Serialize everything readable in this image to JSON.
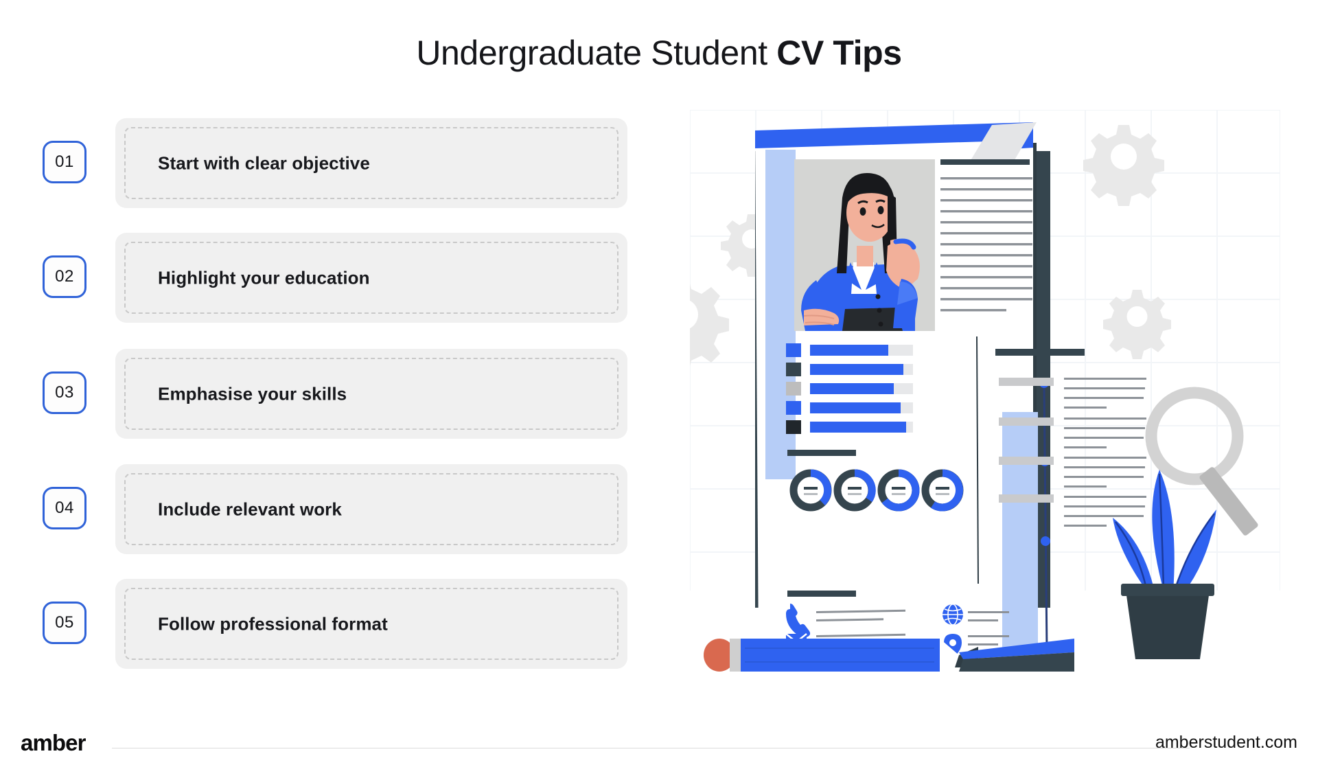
{
  "header": {
    "title_regular": "Undergraduate Student ",
    "title_bold": "CV Tips"
  },
  "tips": [
    {
      "number": "01",
      "label": "Start with clear objective"
    },
    {
      "number": "02",
      "label": "Highlight your education"
    },
    {
      "number": "03",
      "label": "Emphasise your skills"
    },
    {
      "number": "04",
      "label": "Include relevant work"
    },
    {
      "number": "05",
      "label": "Follow professional format"
    }
  ],
  "illustration": {
    "alt": "cv-resume-illustration",
    "parts": [
      "resume-document",
      "person-portrait-photo",
      "skill-bars",
      "donut-charts",
      "timeline",
      "contact-icons",
      "gear-icons",
      "magnifier-icon",
      "potted-plant",
      "pencil"
    ],
    "contact_icons": [
      "phone-icon",
      "email-icon",
      "globe-icon",
      "location-pin-icon"
    ]
  },
  "footer": {
    "logo": "amber",
    "url": "amberstudent.com"
  },
  "colors": {
    "accent_blue": "#2f62d8",
    "bright_blue": "#2f62f0",
    "light_blue": "#b6cdf7",
    "dark_slate": "#35454e",
    "near_black": "#20262b",
    "card_gray": "#f0f0f0",
    "dash_gray": "#c8c8c8",
    "gear_gray": "#e8e8e8",
    "skin": "#f2b09a",
    "eraser": "#d9694f"
  }
}
